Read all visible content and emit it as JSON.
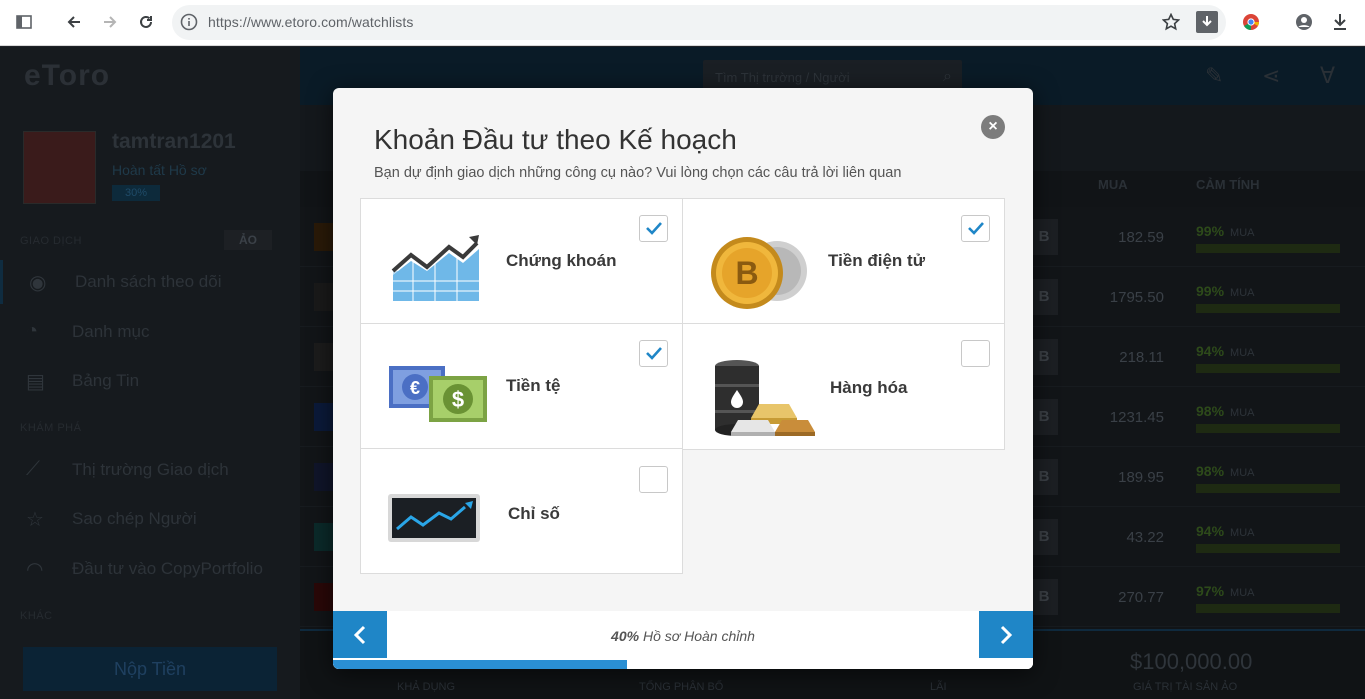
{
  "browser": {
    "url": "https://www.etoro.com/watchlists"
  },
  "app": {
    "logo": "eToro",
    "username": "tamtran1201",
    "profile_link": "Hoàn tất Hồ sơ",
    "profile_pct": "30%",
    "section_trading": "GIAO DỊCH",
    "mode": "ẢO",
    "nav_items": [
      {
        "label": "Danh sách theo dõi",
        "icon": "eye-icon"
      },
      {
        "label": "Danh mục",
        "icon": "pie-chart-icon"
      },
      {
        "label": "Bảng Tin",
        "icon": "newsfeed-icon"
      }
    ],
    "section_explore": "KHÁM PHÁ",
    "explore_items": [
      {
        "label": "Thị trường Giao dịch",
        "icon": "chart-line-icon"
      },
      {
        "label": "Sao chép Người",
        "icon": "star-icon"
      },
      {
        "label": "Đầu tư vào CopyPortfolio",
        "icon": "copyportfolio-icon"
      }
    ],
    "section_other": "KHÁC",
    "deposit": "Nộp Tiền",
    "search_placeholder": "Tìm Thị trường / Người",
    "columns": {
      "buy": "MUA",
      "sentiment": "CẢM TÍNH"
    },
    "rows": [
      {
        "price": "182.59",
        "sentiment": "99%",
        "label": "MUA"
      },
      {
        "price": "1795.50",
        "sentiment": "99%",
        "label": "MUA"
      },
      {
        "price": "218.11",
        "sentiment": "94%",
        "label": "MUA"
      },
      {
        "price": "1231.45",
        "sentiment": "98%",
        "label": "MUA"
      },
      {
        "price": "189.95",
        "sentiment": "98%",
        "label": "MUA"
      },
      {
        "price": "43.22",
        "sentiment": "94%",
        "label": "MUA"
      },
      {
        "price": "270.77",
        "sentiment": "97%",
        "label": "MUA"
      }
    ],
    "row_button": "B",
    "footer": {
      "total": "$100,000.00",
      "available": "KHẢ DỤNG",
      "allocated": "TỔNG PHÂN BỔ",
      "profit": "LÃI",
      "virtual_value": "GIÁ TRỊ TÀI SẢN ẢO"
    }
  },
  "modal": {
    "title": "Khoản Đầu tư theo Kế hoạch",
    "subtitle": "Bạn dự định giao dịch những công cụ nào? Vui lòng chọn các câu trả lời liên quan",
    "options": [
      {
        "label": "Chứng khoán",
        "checked": true,
        "icon": "stocks-chart-icon"
      },
      {
        "label": "Tiền điện tử",
        "checked": true,
        "icon": "bitcoin-coin-icon"
      },
      {
        "label": "Tiền tệ",
        "checked": true,
        "icon": "currency-notes-icon"
      },
      {
        "label": "Hàng hóa",
        "checked": false,
        "icon": "oil-barrel-gold-icon"
      },
      {
        "label": "Chỉ số",
        "checked": false,
        "icon": "index-monitor-icon"
      }
    ],
    "progress_pct": "40%",
    "progress_text": "Hồ sơ Hoàn chỉnh",
    "progress_value": 0.42
  }
}
